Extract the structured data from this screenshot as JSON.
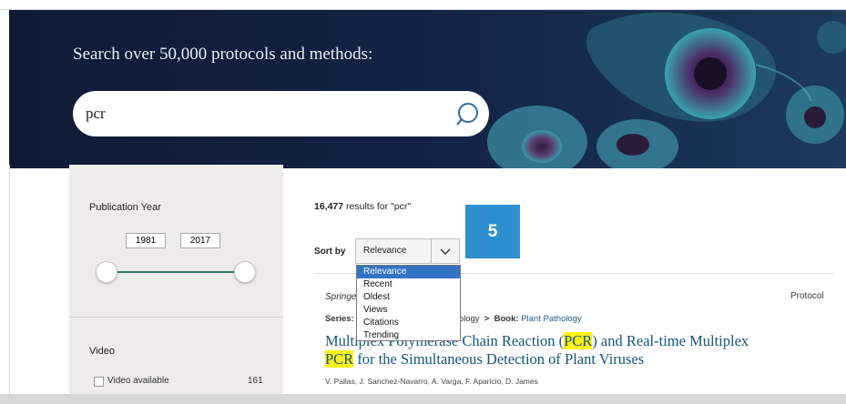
{
  "hero": {
    "title": "Search over 50,000 protocols and methods:"
  },
  "search": {
    "value": "pcr"
  },
  "filters": {
    "publication_year": {
      "title": "Publication Year",
      "from": "1981",
      "to": "2017"
    },
    "video": {
      "title": "Video",
      "option_label": "Video available",
      "option_count": "161"
    }
  },
  "results": {
    "count": "16,477",
    "query_text": " results for \"pcr\"",
    "badge": "5"
  },
  "sort": {
    "label": "Sort by",
    "selected": "Relevance",
    "options": [
      "Relevance",
      "Recent",
      "Oldest",
      "Views",
      "Citations",
      "Trending"
    ]
  },
  "result_item": {
    "publisher_visible": "Springe",
    "type": "Protocol",
    "series_label": "Series:",
    "series_tail": "iology",
    "book_sep": ">",
    "book_label": "Book:",
    "book_name": "Plant Pathology",
    "title_part1": "Multiplex Polymerase Chain Reaction (",
    "title_hl1": "PCR",
    "title_part2": ") and Real-time Multiplex",
    "title_hl2": "PCR",
    "title_part3": " for the Simultaneous Detection of Plant Viruses",
    "authors": "V. Pallas, J. Sanchez-Navarro, A. Varga, F. Aparicio, D. James"
  },
  "colors": {
    "hero_bg": "#142447",
    "link_blue": "#17547a",
    "highlight": "#fdf21a",
    "badge_blue": "#2d8fcf",
    "slider_green": "#2e7a6b",
    "dropdown_selected": "#3374c5"
  }
}
